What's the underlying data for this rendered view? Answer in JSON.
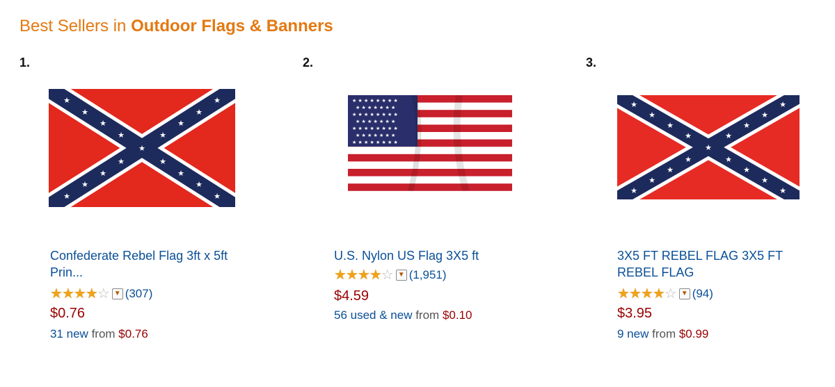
{
  "header": {
    "prefix": "Best Sellers in",
    "category": "Outdoor Flags & Banners"
  },
  "colors": {
    "header_orange": "#e47911",
    "link_blue": "#0a4f97",
    "price_red": "#990000",
    "star_gold": "#f0a31a"
  },
  "products": [
    {
      "rank": "1.",
      "image_icon": "confederate-flag-image",
      "title": "Confederate Rebel Flag 3ft x 5ft Prin...",
      "stars": 4,
      "reviews": "(307)",
      "price": "$0.76",
      "offers_link": "31 new",
      "offers_from": "from",
      "offers_price": "$0.76"
    },
    {
      "rank": "2.",
      "image_icon": "us-flag-image",
      "title": "U.S. Nylon US Flag 3X5 ft",
      "stars": 4,
      "reviews": "(1,951)",
      "price": "$4.59",
      "offers_link": "56 used & new",
      "offers_from": "from",
      "offers_price": "$0.10"
    },
    {
      "rank": "3.",
      "image_icon": "confederate-flag-image",
      "title": "3X5 FT REBEL FLAG 3X5 FT REBEL FLAG",
      "stars": 4,
      "reviews": "(94)",
      "price": "$3.95",
      "offers_link": "9 new",
      "offers_from": "from",
      "offers_price": "$0.99"
    }
  ]
}
